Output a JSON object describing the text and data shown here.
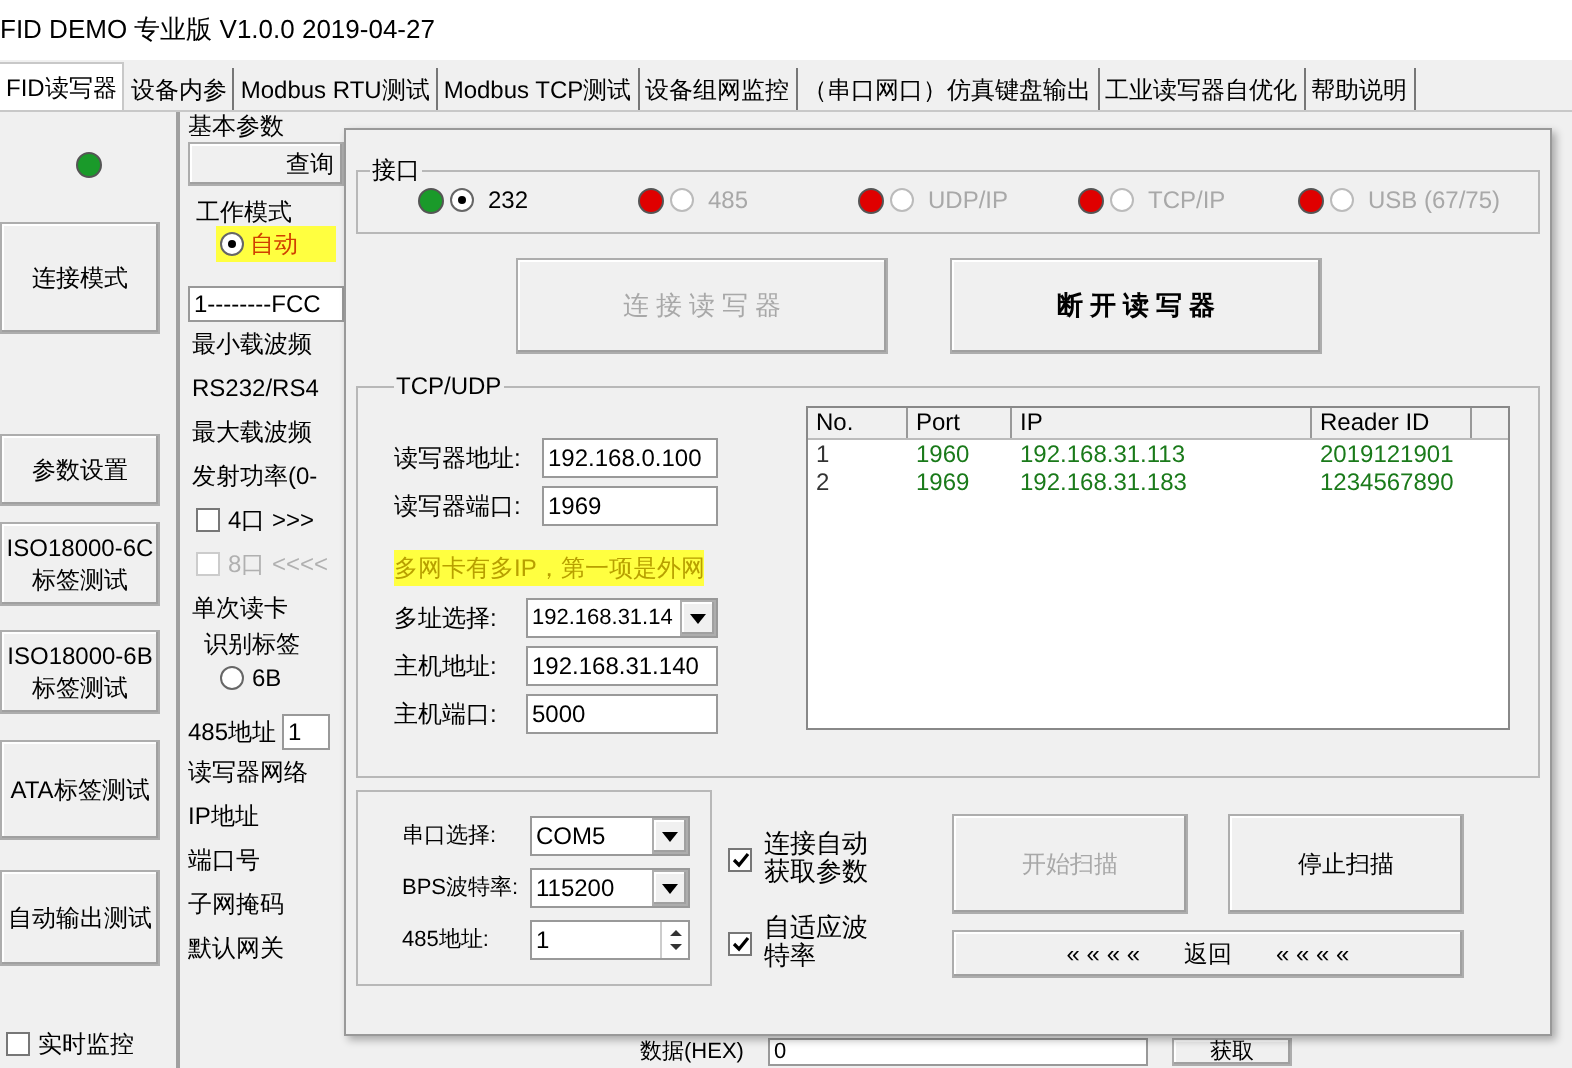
{
  "window": {
    "title": "FID DEMO 专业版 V1.0.0  2019-04-27"
  },
  "tabs": [
    {
      "label": "FID读写器",
      "selected": true
    },
    {
      "label": "设备内参",
      "selected": false
    },
    {
      "label": "Modbus RTU测试",
      "selected": false
    },
    {
      "label": "Modbus TCP测试",
      "selected": false
    },
    {
      "label": "设备组网监控",
      "selected": false
    },
    {
      "label": "（串口网口）仿真键盘输出",
      "selected": false
    },
    {
      "label": "工业读写器自优化",
      "selected": false
    },
    {
      "label": "帮助说明",
      "selected": false
    }
  ],
  "sidebar": {
    "buttons": [
      "连接模式",
      "参数设置",
      "ISO18000-6C 标签测试",
      "ISO18000-6B 标签测试",
      "ATA标签测试",
      "自动输出测试"
    ],
    "monitor": {
      "label": "实时监控",
      "checked": false
    }
  },
  "basic_params": {
    "title": "基本参数",
    "query_button": "查询",
    "work_mode": {
      "title": "工作模式",
      "option": "自动",
      "selected": true
    },
    "region_select": "1--------FCC",
    "rows": [
      {
        "kind": "label",
        "text": "最小载波频"
      },
      {
        "kind": "label",
        "text": "RS232/RS4"
      },
      {
        "kind": "label",
        "text": "最大载波频"
      },
      {
        "kind": "label",
        "text": "发射功率(0-"
      },
      {
        "kind": "checkbox",
        "text": "4口 >>>",
        "checked": false,
        "disabled": false
      },
      {
        "kind": "checkbox",
        "text": "8口 <<<<",
        "checked": false,
        "disabled": true
      },
      {
        "kind": "label",
        "text": "单次读卡"
      }
    ],
    "tag_type": {
      "title": "识别标签",
      "option": "6B",
      "selected": false
    },
    "address_label": "485地址",
    "address_value": "1",
    "network_title": "读写器网络",
    "network_rows": [
      "IP地址",
      "端口号",
      "子网掩码",
      "默认网关"
    ]
  },
  "bottom_bar": {
    "label": "数据(HEX)",
    "value": "0",
    "button": "获取"
  },
  "dialog": {
    "interface": {
      "title": "接口",
      "options": [
        {
          "label": "232",
          "selected": true,
          "disabled": false,
          "color": "#1a9a2a"
        },
        {
          "label": "485",
          "selected": false,
          "disabled": true,
          "color": "#e00000"
        },
        {
          "label": "UDP/IP",
          "selected": false,
          "disabled": true,
          "color": "#e00000"
        },
        {
          "label": "TCP/IP",
          "selected": false,
          "disabled": true,
          "color": "#e00000"
        },
        {
          "label": "USB (67/75)",
          "selected": false,
          "disabled": true,
          "color": "#e00000"
        }
      ]
    },
    "connect_buttons": [
      {
        "label": "连 接 读 写 器",
        "disabled": true
      },
      {
        "label": "断 开 读 写 器",
        "disabled": false
      }
    ],
    "tcp_udp": {
      "title": "TCP/UDP",
      "fields": [
        {
          "label": "读写器地址:",
          "value": "192.168.0.100"
        },
        {
          "label": "读写器端口:",
          "value": "1969"
        }
      ],
      "note": "多网卡有多IP，第一项是外网",
      "host_fields": [
        {
          "kind": "select",
          "label": "多址选择:",
          "value": "192.168.31.14"
        },
        {
          "kind": "text",
          "label": "主机地址:",
          "value": "192.168.31.140"
        },
        {
          "kind": "text",
          "label": "主机端口:",
          "value": "5000"
        }
      ],
      "table": {
        "columns": [
          "No.",
          "Port",
          "IP",
          "Reader ID"
        ],
        "rows": [
          [
            "1",
            "1960",
            "192.168.31.113",
            "2019121901"
          ],
          [
            "2",
            "1969",
            "192.168.31.183",
            "1234567890"
          ]
        ]
      }
    },
    "serial": {
      "fields": [
        {
          "kind": "select",
          "label": "串口选择:",
          "value": "COM5"
        },
        {
          "kind": "select",
          "label": "BPS波特率:",
          "value": "115200"
        },
        {
          "kind": "spin",
          "label": "485地址:",
          "value": "1"
        }
      ]
    },
    "options": [
      {
        "label": "连接自动获取参数",
        "checked": true
      },
      {
        "label": "自适应波特率",
        "checked": true
      }
    ],
    "scan_buttons": [
      {
        "label": "开始扫描",
        "disabled": true
      },
      {
        "label": "停止扫描",
        "disabled": false
      }
    ],
    "return_bar": {
      "left": "« « « «",
      "label": "返回",
      "right": "« « « «"
    }
  }
}
